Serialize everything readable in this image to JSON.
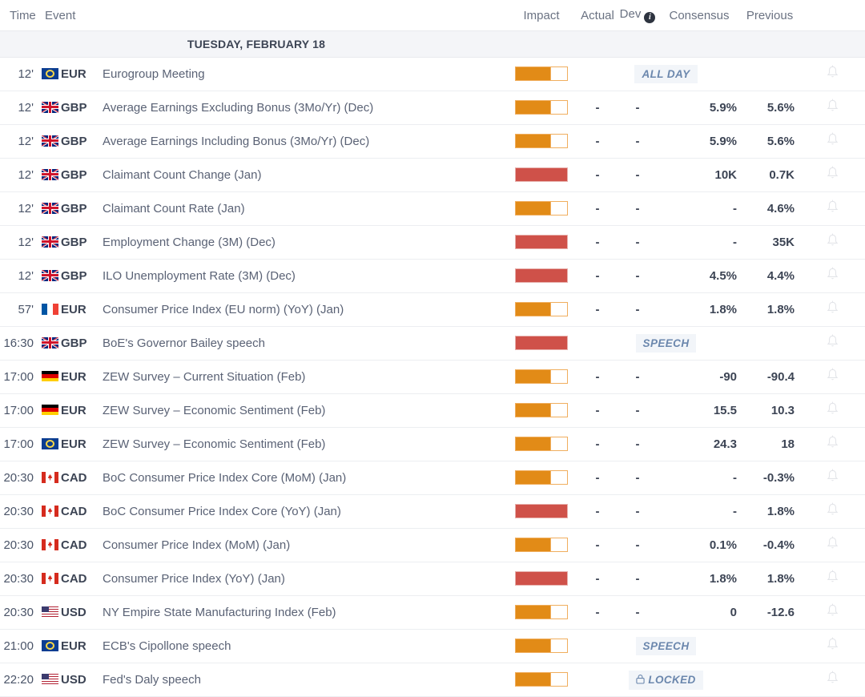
{
  "header": {
    "time": "Time",
    "event": "Event",
    "impact": "Impact",
    "actual": "Actual",
    "dev": "Dev",
    "info_icon": "info-icon",
    "consensus": "Consensus",
    "previous": "Previous"
  },
  "day_header": "TUESDAY, FEBRUARY 18",
  "colors": {
    "impact_medium": "#e28b17",
    "impact_high": "#cf5149",
    "badge_text": "#6b87ad",
    "badge_bg": "#f2f5f9",
    "day_header_bg": "#f4f5f8",
    "row_border": "#eceef1",
    "value_text": "#3c4454",
    "event_text": "#5a6275"
  },
  "rows": [
    {
      "time": "12'",
      "flag": "eu",
      "currency": "EUR",
      "event": "Eurogroup Meeting",
      "impact": "medium",
      "badge": "ALL DAY",
      "locked": false,
      "actual": "",
      "dev": "",
      "consensus": "",
      "previous": "",
      "bell": true
    },
    {
      "time": "12'",
      "flag": "gb",
      "currency": "GBP",
      "event": "Average Earnings Excluding Bonus (3Mo/Yr) (Dec)",
      "impact": "medium",
      "badge": "",
      "actual": "-",
      "dev": "-",
      "consensus": "5.9%",
      "previous": "5.6%",
      "bell": true
    },
    {
      "time": "12'",
      "flag": "gb",
      "currency": "GBP",
      "event": "Average Earnings Including Bonus (3Mo/Yr) (Dec)",
      "impact": "medium",
      "badge": "",
      "actual": "-",
      "dev": "-",
      "consensus": "5.9%",
      "previous": "5.6%",
      "bell": true
    },
    {
      "time": "12'",
      "flag": "gb",
      "currency": "GBP",
      "event": "Claimant Count Change (Jan)",
      "impact": "high",
      "badge": "",
      "actual": "-",
      "dev": "-",
      "consensus": "10K",
      "previous": "0.7K",
      "bell": true
    },
    {
      "time": "12'",
      "flag": "gb",
      "currency": "GBP",
      "event": "Claimant Count Rate (Jan)",
      "impact": "medium",
      "badge": "",
      "actual": "-",
      "dev": "-",
      "consensus": "-",
      "previous": "4.6%",
      "bell": true
    },
    {
      "time": "12'",
      "flag": "gb",
      "currency": "GBP",
      "event": "Employment Change (3M) (Dec)",
      "impact": "high",
      "badge": "",
      "actual": "-",
      "dev": "-",
      "consensus": "-",
      "previous": "35K",
      "bell": true
    },
    {
      "time": "12'",
      "flag": "gb",
      "currency": "GBP",
      "event": "ILO Unemployment Rate (3M) (Dec)",
      "impact": "high",
      "badge": "",
      "actual": "-",
      "dev": "-",
      "consensus": "4.5%",
      "previous": "4.4%",
      "bell": true
    },
    {
      "time": "57'",
      "flag": "fr",
      "currency": "EUR",
      "event": "Consumer Price Index (EU norm) (YoY) (Jan)",
      "impact": "medium",
      "badge": "",
      "actual": "-",
      "dev": "-",
      "consensus": "1.8%",
      "previous": "1.8%",
      "bell": true
    },
    {
      "time": "16:30",
      "flag": "gb",
      "currency": "GBP",
      "event": "BoE's Governor Bailey speech",
      "impact": "high",
      "badge": "SPEECH",
      "locked": false,
      "actual": "",
      "dev": "",
      "consensus": "",
      "previous": "",
      "bell": true
    },
    {
      "time": "17:00",
      "flag": "de",
      "currency": "EUR",
      "event": "ZEW Survey – Current Situation (Feb)",
      "impact": "medium",
      "badge": "",
      "actual": "-",
      "dev": "-",
      "consensus": "-90",
      "previous": "-90.4",
      "bell": true
    },
    {
      "time": "17:00",
      "flag": "de",
      "currency": "EUR",
      "event": "ZEW Survey – Economic Sentiment (Feb)",
      "impact": "medium",
      "badge": "",
      "actual": "-",
      "dev": "-",
      "consensus": "15.5",
      "previous": "10.3",
      "bell": true
    },
    {
      "time": "17:00",
      "flag": "eu",
      "currency": "EUR",
      "event": "ZEW Survey – Economic Sentiment (Feb)",
      "impact": "medium",
      "badge": "",
      "actual": "-",
      "dev": "-",
      "consensus": "24.3",
      "previous": "18",
      "bell": true
    },
    {
      "time": "20:30",
      "flag": "ca",
      "currency": "CAD",
      "event": "BoC Consumer Price Index Core (MoM) (Jan)",
      "impact": "medium",
      "badge": "",
      "actual": "-",
      "dev": "-",
      "consensus": "-",
      "previous": "-0.3%",
      "bell": true
    },
    {
      "time": "20:30",
      "flag": "ca",
      "currency": "CAD",
      "event": "BoC Consumer Price Index Core (YoY) (Jan)",
      "impact": "high",
      "badge": "",
      "actual": "-",
      "dev": "-",
      "consensus": "-",
      "previous": "1.8%",
      "bell": true
    },
    {
      "time": "20:30",
      "flag": "ca",
      "currency": "CAD",
      "event": "Consumer Price Index (MoM) (Jan)",
      "impact": "medium",
      "badge": "",
      "actual": "-",
      "dev": "-",
      "consensus": "0.1%",
      "previous": "-0.4%",
      "bell": true
    },
    {
      "time": "20:30",
      "flag": "ca",
      "currency": "CAD",
      "event": "Consumer Price Index (YoY) (Jan)",
      "impact": "high",
      "badge": "",
      "actual": "-",
      "dev": "-",
      "consensus": "1.8%",
      "previous": "1.8%",
      "bell": true
    },
    {
      "time": "20:30",
      "flag": "us",
      "currency": "USD",
      "event": "NY Empire State Manufacturing Index (Feb)",
      "impact": "medium",
      "badge": "",
      "actual": "-",
      "dev": "-",
      "consensus": "0",
      "previous": "-12.6",
      "bell": true
    },
    {
      "time": "21:00",
      "flag": "eu",
      "currency": "EUR",
      "event": "ECB's Cipollone speech",
      "impact": "medium",
      "badge": "SPEECH",
      "locked": false,
      "actual": "",
      "dev": "",
      "consensus": "",
      "previous": "",
      "bell": true
    },
    {
      "time": "22:20",
      "flag": "us",
      "currency": "USD",
      "event": "Fed's Daly speech",
      "impact": "medium",
      "badge": "LOCKED",
      "locked": true,
      "actual": "",
      "dev": "",
      "consensus": "",
      "previous": "",
      "bell": true
    }
  ]
}
